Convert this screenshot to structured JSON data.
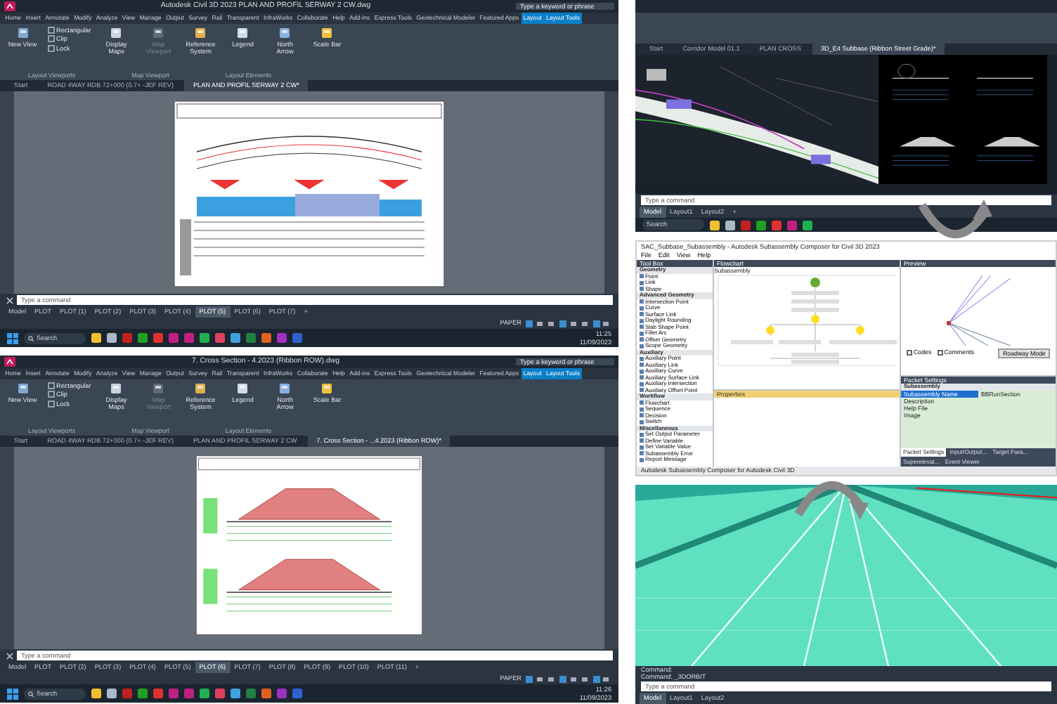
{
  "cad_windows": [
    {
      "kind": "plan_profile",
      "title": "Autodesk Civil 3D 2023   PLAN AND PROFIL SERWAY 2 CW.dwg",
      "search_placeholder": "Type a keyword or phrase",
      "ribbon_tabs": [
        {
          "label": "Home",
          "selected": false
        },
        {
          "label": "Insert",
          "selected": false
        },
        {
          "label": "Annotate",
          "selected": false
        },
        {
          "label": "Modify",
          "selected": false
        },
        {
          "label": "Analyze",
          "selected": false
        },
        {
          "label": "View",
          "selected": false
        },
        {
          "label": "Manage",
          "selected": false
        },
        {
          "label": "Output",
          "selected": false
        },
        {
          "label": "Survey",
          "selected": false
        },
        {
          "label": "Rail",
          "selected": false
        },
        {
          "label": "Transparent",
          "selected": false
        },
        {
          "label": "InfraWorks",
          "selected": false
        },
        {
          "label": "Collaborate",
          "selected": false
        },
        {
          "label": "Help",
          "selected": false
        },
        {
          "label": "Add-ins",
          "selected": false
        },
        {
          "label": "Express Tools",
          "selected": false
        },
        {
          "label": "Geotechnical Modeler",
          "selected": false
        },
        {
          "label": "Featured Apps",
          "selected": false
        },
        {
          "label": "Layout",
          "selected": true
        },
        {
          "label": "Layout Tools",
          "selected": true
        }
      ],
      "ribbon_buttons": [
        {
          "label": "New View",
          "disabled": false
        },
        {
          "label": "Display Maps",
          "disabled": false
        },
        {
          "label": "Map Viewport",
          "disabled": true
        },
        {
          "label": "Reference System",
          "disabled": false
        },
        {
          "label": "Legend",
          "disabled": false
        },
        {
          "label": "North Arrow",
          "disabled": false
        },
        {
          "label": "Scale Bar",
          "disabled": false
        }
      ],
      "viewport_tools": [
        "Rectangular",
        "Clip",
        "Lock"
      ],
      "panels": [
        "Layout Viewports",
        "Map Viewport",
        "Layout Elements"
      ],
      "file_tabs": [
        {
          "label": "Start",
          "selected": false
        },
        {
          "label": "ROAD 4WAY RDB 72+000 (0.7+ -JEF REV)",
          "selected": false
        },
        {
          "label": "PLAN AND PROFIL SERWAY 2 CW*",
          "selected": true
        }
      ],
      "command_placeholder": "Type a command",
      "layout_tabs": [
        {
          "label": "Model",
          "selected": false
        },
        {
          "label": "PLOT",
          "selected": false
        },
        {
          "label": "PLOT (1)",
          "selected": false
        },
        {
          "label": "PLOT (2)",
          "selected": false
        },
        {
          "label": "PLOT (3)",
          "selected": false
        },
        {
          "label": "PLOT (4)",
          "selected": false
        },
        {
          "label": "PLOT (5)",
          "selected": true
        },
        {
          "label": "PLOT (6)",
          "selected": false
        },
        {
          "label": "PLOT (7)",
          "selected": false
        },
        {
          "label": "+",
          "selected": false
        }
      ],
      "status": "PAPER",
      "taskbar_search": "Search",
      "time": "11:25",
      "date": "11/09/2023"
    },
    {
      "kind": "cross_sections",
      "title": "7. Cross Section - 4.2023 (Ribbon ROW).dwg",
      "search_placeholder": "Type a keyword or phrase",
      "ribbon_tabs": [
        {
          "label": "Home",
          "selected": false
        },
        {
          "label": "Insert",
          "selected": false
        },
        {
          "label": "Annotate",
          "selected": false
        },
        {
          "label": "Modify",
          "selected": false
        },
        {
          "label": "Analyze",
          "selected": false
        },
        {
          "label": "View",
          "selected": false
        },
        {
          "label": "Manage",
          "selected": false
        },
        {
          "label": "Output",
          "selected": false
        },
        {
          "label": "Survey",
          "selected": false
        },
        {
          "label": "Rail",
          "selected": false
        },
        {
          "label": "Transparent",
          "selected": false
        },
        {
          "label": "InfraWorks",
          "selected": false
        },
        {
          "label": "Collaborate",
          "selected": false
        },
        {
          "label": "Help",
          "selected": false
        },
        {
          "label": "Add-ins",
          "selected": false
        },
        {
          "label": "Express Tools",
          "selected": false
        },
        {
          "label": "Geotechnical Modeler",
          "selected": false
        },
        {
          "label": "Featured Apps",
          "selected": false
        },
        {
          "label": "Layout",
          "selected": true
        },
        {
          "label": "Layout Tools",
          "selected": true
        }
      ],
      "ribbon_buttons": [
        {
          "label": "New View",
          "disabled": false
        },
        {
          "label": "Display Maps",
          "disabled": false
        },
        {
          "label": "Map Viewport",
          "disabled": true
        },
        {
          "label": "Reference System",
          "disabled": false
        },
        {
          "label": "Legend",
          "disabled": false
        },
        {
          "label": "North Arrow",
          "disabled": false
        },
        {
          "label": "Scale Bar",
          "disabled": false
        }
      ],
      "viewport_tools": [
        "Rectangular",
        "Clip",
        "Lock"
      ],
      "panels": [
        "Layout Viewports",
        "Map Viewport",
        "Layout Elements"
      ],
      "file_tabs": [
        {
          "label": "Start",
          "selected": false
        },
        {
          "label": "ROAD 4WAY RDB 72+000 (0.7+ -JEF REV)",
          "selected": false
        },
        {
          "label": "PLAN AND PROFIL SERWAY 2 CW",
          "selected": false
        },
        {
          "label": "7. Cross Section - ...4.2023 (Ribbon ROW)*",
          "selected": true
        }
      ],
      "command_placeholder": "Type a command",
      "layout_tabs": [
        {
          "label": "Model",
          "selected": false
        },
        {
          "label": "PLOT",
          "selected": false
        },
        {
          "label": "PLOT (2)",
          "selected": false
        },
        {
          "label": "PLOT (3)",
          "selected": false
        },
        {
          "label": "PLOT (4)",
          "selected": false
        },
        {
          "label": "PLOT (5)",
          "selected": false
        },
        {
          "label": "PLOT (6)",
          "selected": true
        },
        {
          "label": "PLOT (7)",
          "selected": false
        },
        {
          "label": "PLOT (8)",
          "selected": false
        },
        {
          "label": "PLOT (9)",
          "selected": false
        },
        {
          "label": "PLOT (10)",
          "selected": false
        },
        {
          "label": "PLOT (11)",
          "selected": false
        },
        {
          "label": "+",
          "selected": false
        }
      ],
      "status": "PAPER",
      "taskbar_search": "Search",
      "time": "11:26",
      "date": "11/09/2023"
    }
  ],
  "model_window": {
    "file_tabs": [
      {
        "label": "Start",
        "selected": false
      },
      {
        "label": "Corridor Model 01.1",
        "selected": false
      },
      {
        "label": "PLAN CROSS",
        "selected": false
      },
      {
        "label": "3D_E4 Subbase (Ribbon Street Grade)*",
        "selected": true
      }
    ],
    "command_placeholder": "Type a command",
    "layout_tabs": [
      {
        "label": "Model",
        "selected": true
      },
      {
        "label": "Layout1",
        "selected": false
      },
      {
        "label": "Layout2",
        "selected": false
      },
      {
        "label": "+",
        "selected": false
      }
    ],
    "taskbar_search": "Search"
  },
  "composer": {
    "title": "SAC_Subbase_Subassembly - Autodesk Subassembly Composer for Civil 3D 2023",
    "menu": [
      "File",
      "Edit",
      "View",
      "Help"
    ],
    "toolbox_title": "Tool Box",
    "toolbox": [
      {
        "group": "Geometry",
        "items": [
          "Point",
          "Link",
          "Shape"
        ]
      },
      {
        "group": "Advanced Geometry",
        "items": [
          "Intersection Point",
          "Curve",
          "Surface Link",
          "Daylight Rounding",
          "Slab Shape Point",
          "Fillet Arc",
          "Offset Geometry",
          "Scope Geometry"
        ]
      },
      {
        "group": "Auxiliary",
        "items": [
          "Auxiliary Point",
          "Auxiliary Link",
          "Auxiliary Curve",
          "Auxiliary Surface Link",
          "Auxiliary Intersection",
          "Auxiliary Offset Point"
        ]
      },
      {
        "group": "Workflow",
        "items": [
          "Flowchart",
          "Sequence",
          "Decision",
          "Switch"
        ]
      },
      {
        "group": "Miscellaneous",
        "items": [
          "Set Output Parameter",
          "Define Variable",
          "Set Variable Value",
          "Subassembly Error",
          "Report Message"
        ]
      }
    ],
    "flowchart_title": "Flowchart",
    "flowchart_label": "Subassembly",
    "properties_title": "Properties",
    "preview_title": "Preview",
    "preview_checks": [
      {
        "label": "Codes",
        "checked": false
      },
      {
        "label": "Comments",
        "checked": false
      }
    ],
    "preview_button": "Roadway Mode",
    "packet_title": "Packet Settings",
    "packet_section": "Subassembly",
    "packet_rows": [
      {
        "label": "Subassembly Name",
        "value": "BBRunSection",
        "selected": true
      },
      {
        "label": "Description",
        "selected": false
      },
      {
        "label": "Help File",
        "selected": false
      },
      {
        "label": "Image",
        "selected": false
      }
    ],
    "bottom_tabs": [
      {
        "label": "Packet Settings",
        "selected": true
      },
      {
        "label": "Input/Output...",
        "selected": false
      },
      {
        "label": "Target Para...",
        "selected": false
      },
      {
        "label": "Superelevat...",
        "selected": false
      },
      {
        "label": "Event Viewer",
        "selected": false
      }
    ],
    "status": "Autodesk Subassembly Composer for Autodesk Civil 3D"
  },
  "render_window": {
    "command_lines": [
      "Command:",
      "Command: _3DORBIT"
    ],
    "command_placeholder": "Type a command",
    "layout_tabs": [
      {
        "label": "Model",
        "selected": true
      },
      {
        "label": "Layout1",
        "selected": false
      },
      {
        "label": "Layout2",
        "selected": false
      }
    ]
  }
}
